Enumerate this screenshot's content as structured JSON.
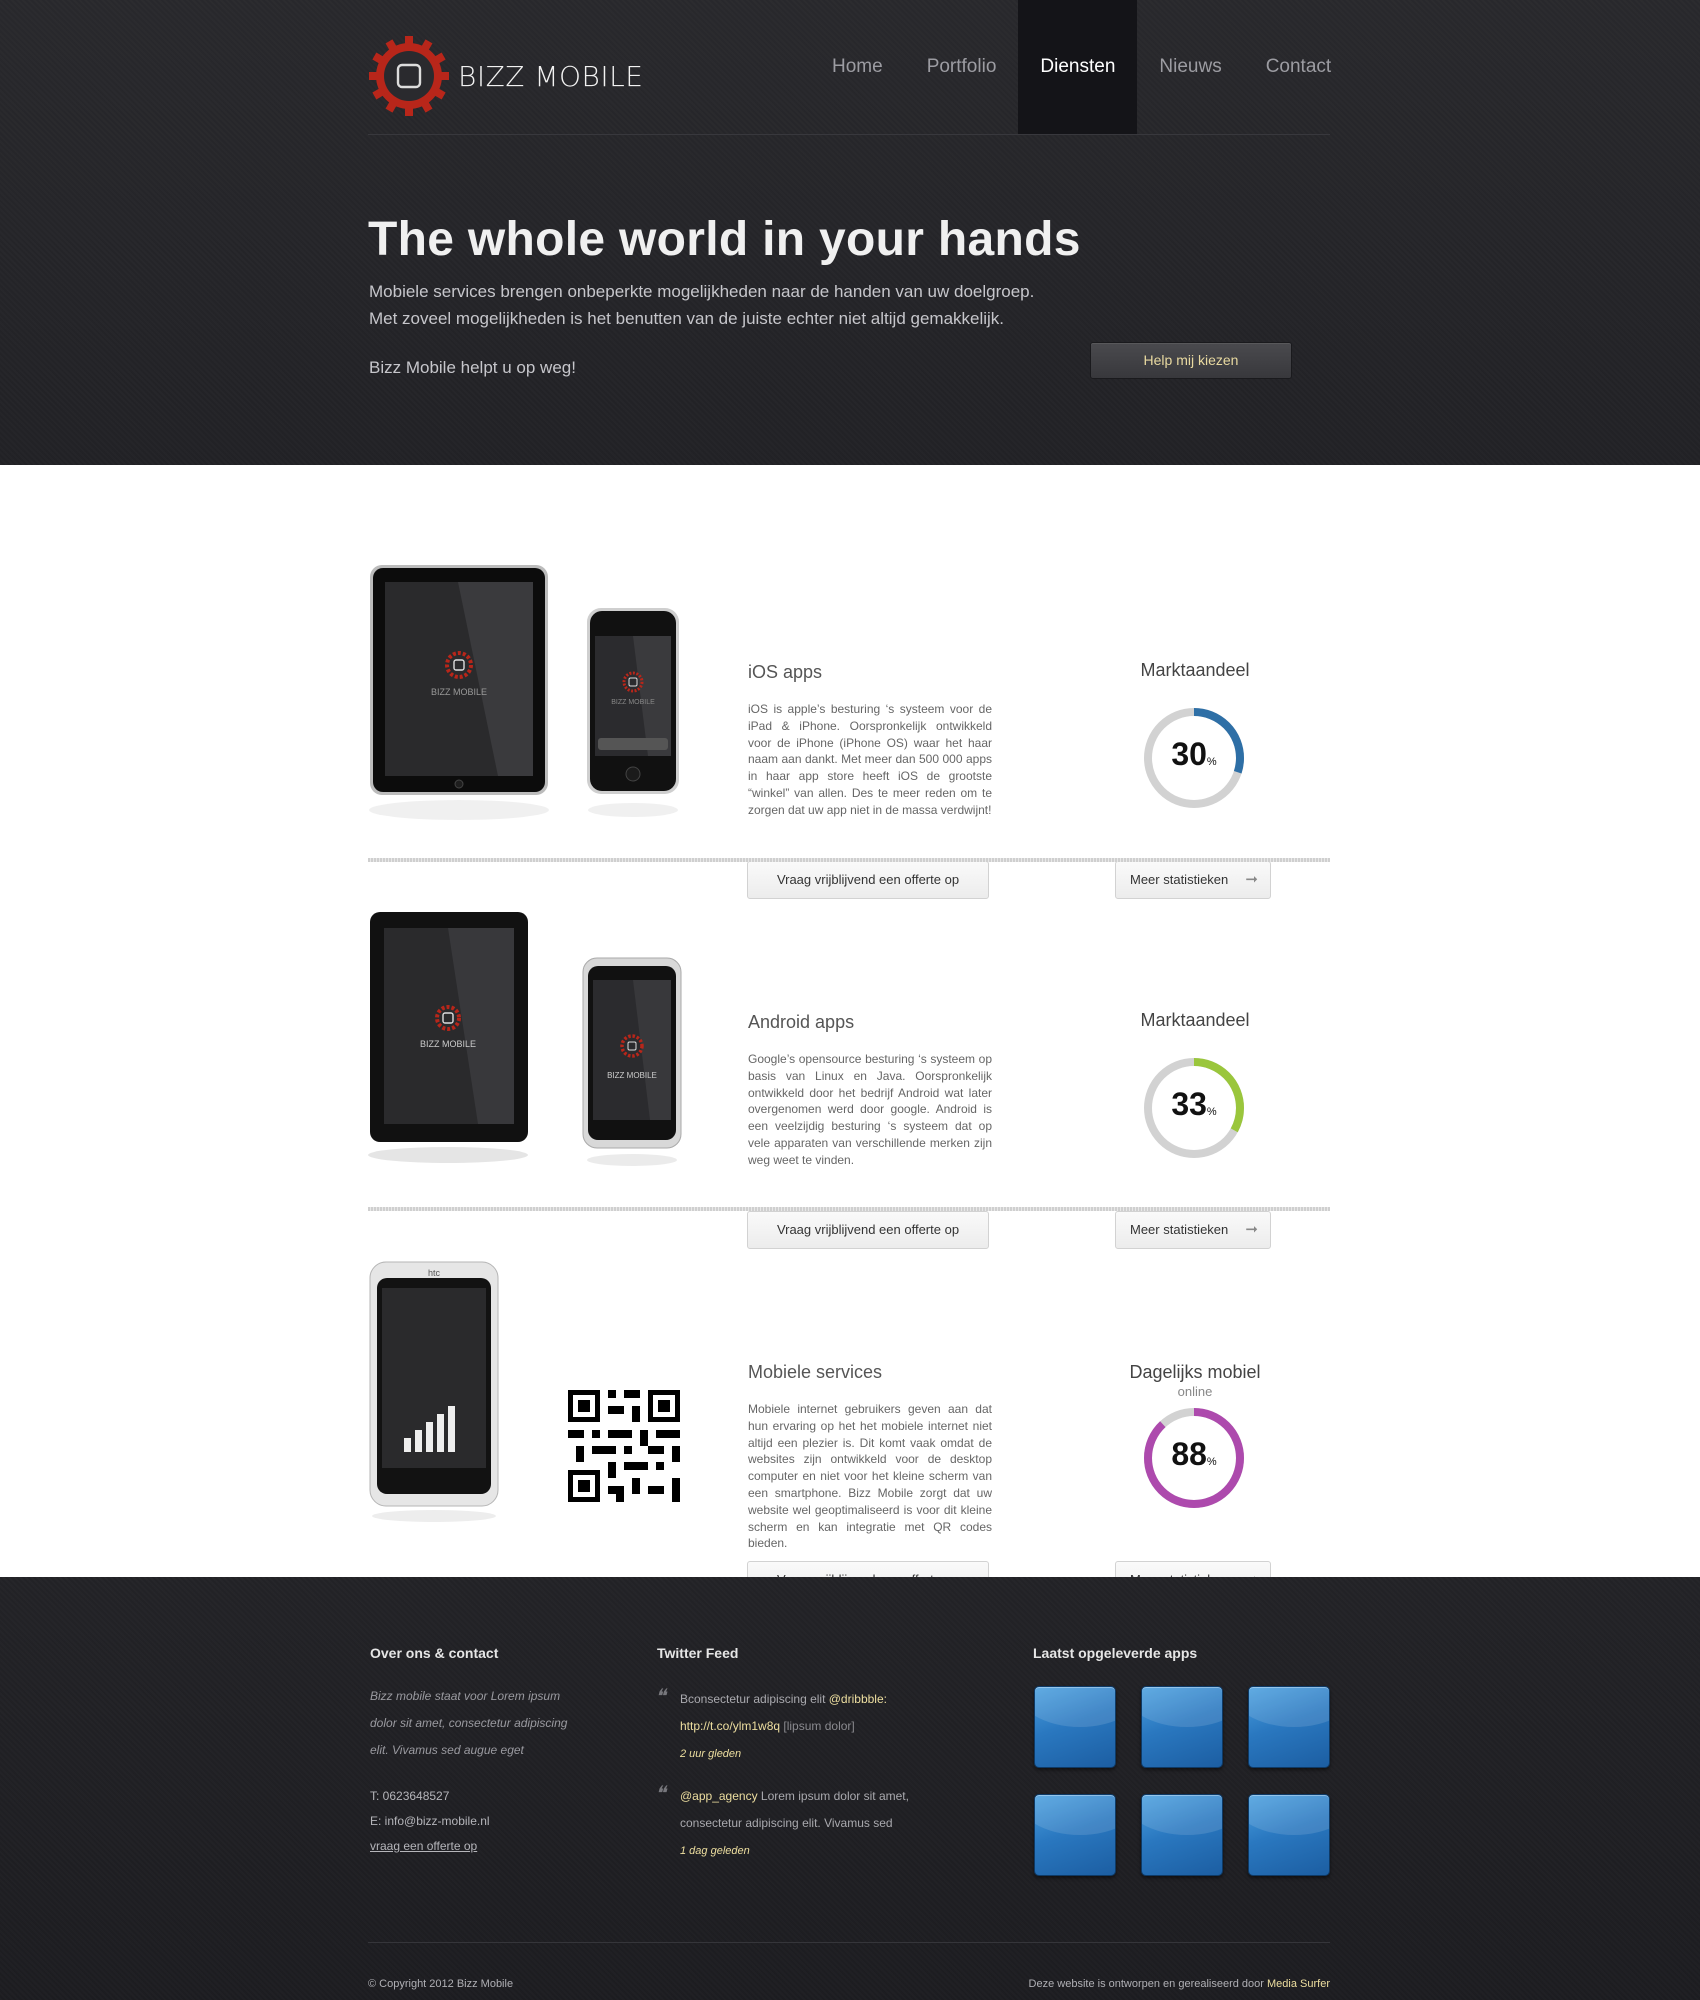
{
  "header": {
    "brand": "BIZZ MOBILE",
    "nav": [
      {
        "label": "Home",
        "active": false
      },
      {
        "label": "Portfolio",
        "active": false
      },
      {
        "label": "Diensten",
        "active": true
      },
      {
        "label": "Nieuws",
        "active": false
      },
      {
        "label": "Contact",
        "active": false
      }
    ],
    "hero_title": "The whole world in your hands",
    "hero_line1": "Mobiele services brengen onbeperkte mogelijkheden naar de handen van uw doelgroep.",
    "hero_line2": "Met zoveel mogelijkheden is het benutten van de juiste echter niet altijd gemakkelijk.",
    "hero_sub": "Bizz Mobile helpt u op weg!",
    "help_button": "Help mij kiezen"
  },
  "services": [
    {
      "title": "iOS apps",
      "text": "iOS is apple’s besturing ‘s systeem voor de iPad & iPhone. Oorspronkelijk ontwikkeld voor de iPhone (iPhone OS) waar het haar naam aan dankt. Met meer dan 500 000 apps in haar app store heeft iOS de grootste “winkel” van allen. Des te meer reden om te zorgen dat uw app niet in de massa verdwijnt!",
      "offer_button": "Vraag vrijblijvend een offerte op",
      "stat_title": "Marktaandeel",
      "stat_sub": "",
      "stat_value": "30",
      "stat_unit": "%",
      "stat_fraction": 0.3,
      "stat_color": "#2e6fa6",
      "stat_button": "Meer statistieken",
      "device_brand": "BIZZ MOBILE"
    },
    {
      "title": "Android apps",
      "text": "Google’s opensource besturing ‘s systeem op basis van Linux en Java. Oorspronkelijk ontwikkeld door het bedrijf Android wat later overgenomen werd door google. Android is een veelzijdig besturing ‘s systeem dat op vele apparaten van verschillende merken zijn weg weet te vinden.",
      "offer_button": "Vraag vrijblijvend een offerte op",
      "stat_title": "Marktaandeel",
      "stat_sub": "",
      "stat_value": "33",
      "stat_unit": "%",
      "stat_fraction": 0.33,
      "stat_color": "#9ac63c",
      "stat_button": "Meer statistieken",
      "device_brand": "BIZZ MOBILE"
    },
    {
      "title": "Mobiele services",
      "text": "Mobiele internet gebruikers geven aan dat hun ervaring op het het mobiele internet niet altijd een plezier is. Dit komt vaak omdat de websites zijn ontwikkeld voor de desktop computer en niet voor het kleine scherm van een smartphone. Bizz Mobile zorgt dat uw website wel geoptimaliseerd is voor dit kleine scherm en kan integratie met QR codes bieden.",
      "offer_button": "Vraag vrijblijvend een offerte op",
      "stat_title": "Dagelijks mobiel",
      "stat_sub": "online",
      "stat_value": "88",
      "stat_unit": "%",
      "stat_fraction": 0.88,
      "stat_color": "#ad4aad",
      "stat_button": "Meer statistieken",
      "device_brand": "htc"
    }
  ],
  "footer": {
    "about_title": "Over ons & contact",
    "about_text": "Bizz mobile staat voor Lorem ipsum dolor sit amet, consectetur adipiscing elit. Vivamus sed augue eget",
    "phone": "T:   0623648527",
    "email": "E:  info@bizz-mobile.nl",
    "offer_link": "vraag een offerte op",
    "twitter_title": "Twitter Feed",
    "tweets": [
      {
        "pre": "Bconsectetur adipiscing elit ",
        "mention": "@dribbble:",
        "link": "http://t.co/ylm1w8q",
        "post": " [lipsum dolor]",
        "when": "2 uur gleden"
      },
      {
        "mention": "@app_agency",
        "post": " Lorem ipsum dolor sit amet, consectetur adipiscing elit. Vivamus sed",
        "when": "1 dag geleden"
      }
    ],
    "apps_title": "Laatst opgeleverde apps",
    "copyright": "© Copyright 2012 Bizz Mobile",
    "credits_pre": "Deze website is ontworpen en gerealiseerd door ",
    "credits_link": "Media Surfer"
  }
}
